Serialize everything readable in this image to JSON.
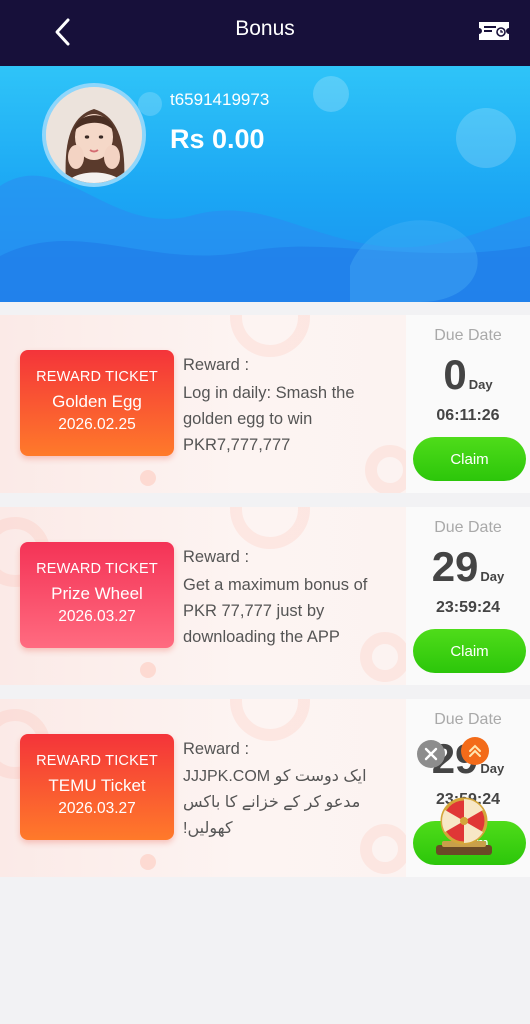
{
  "header": {
    "title": "Bonus"
  },
  "profile": {
    "username": "t6591419973",
    "balance": "Rs 0.00"
  },
  "labels": {
    "reward": "Reward :",
    "due_date": "Due Date",
    "day_unit": "Day",
    "claim": "Claim"
  },
  "tickets": [
    {
      "type": "REWARD TICKET",
      "name": "Golden Egg",
      "date": "2026.02.25",
      "reward_text": "Log in daily: Smash the golden egg to win PKR7,777,777",
      "days": "0",
      "time": "06:11:26"
    },
    {
      "type": "REWARD TICKET",
      "name": "Prize Wheel",
      "date": "2026.03.27",
      "reward_text": "Get a maximum bonus of PKR 77,777 just by downloading the APP",
      "days": "29",
      "time": "23:59:24"
    },
    {
      "type": "REWARD TICKET",
      "name": "TEMU Ticket",
      "date": "2026.03.27",
      "reward_text_ltr": "JJJPK.COM",
      "reward_text_rtl": "ایک دوست کو مدعو کر کے خزانے کا باکس کھولیں!",
      "days": "29",
      "time": "23:59:24"
    }
  ],
  "colors": {
    "topbar": "#17103a",
    "hero": "#1ba6f4",
    "claim": "#2cc60a",
    "ticket_orange": "#f4343a",
    "ticket_pink": "#f43356"
  }
}
